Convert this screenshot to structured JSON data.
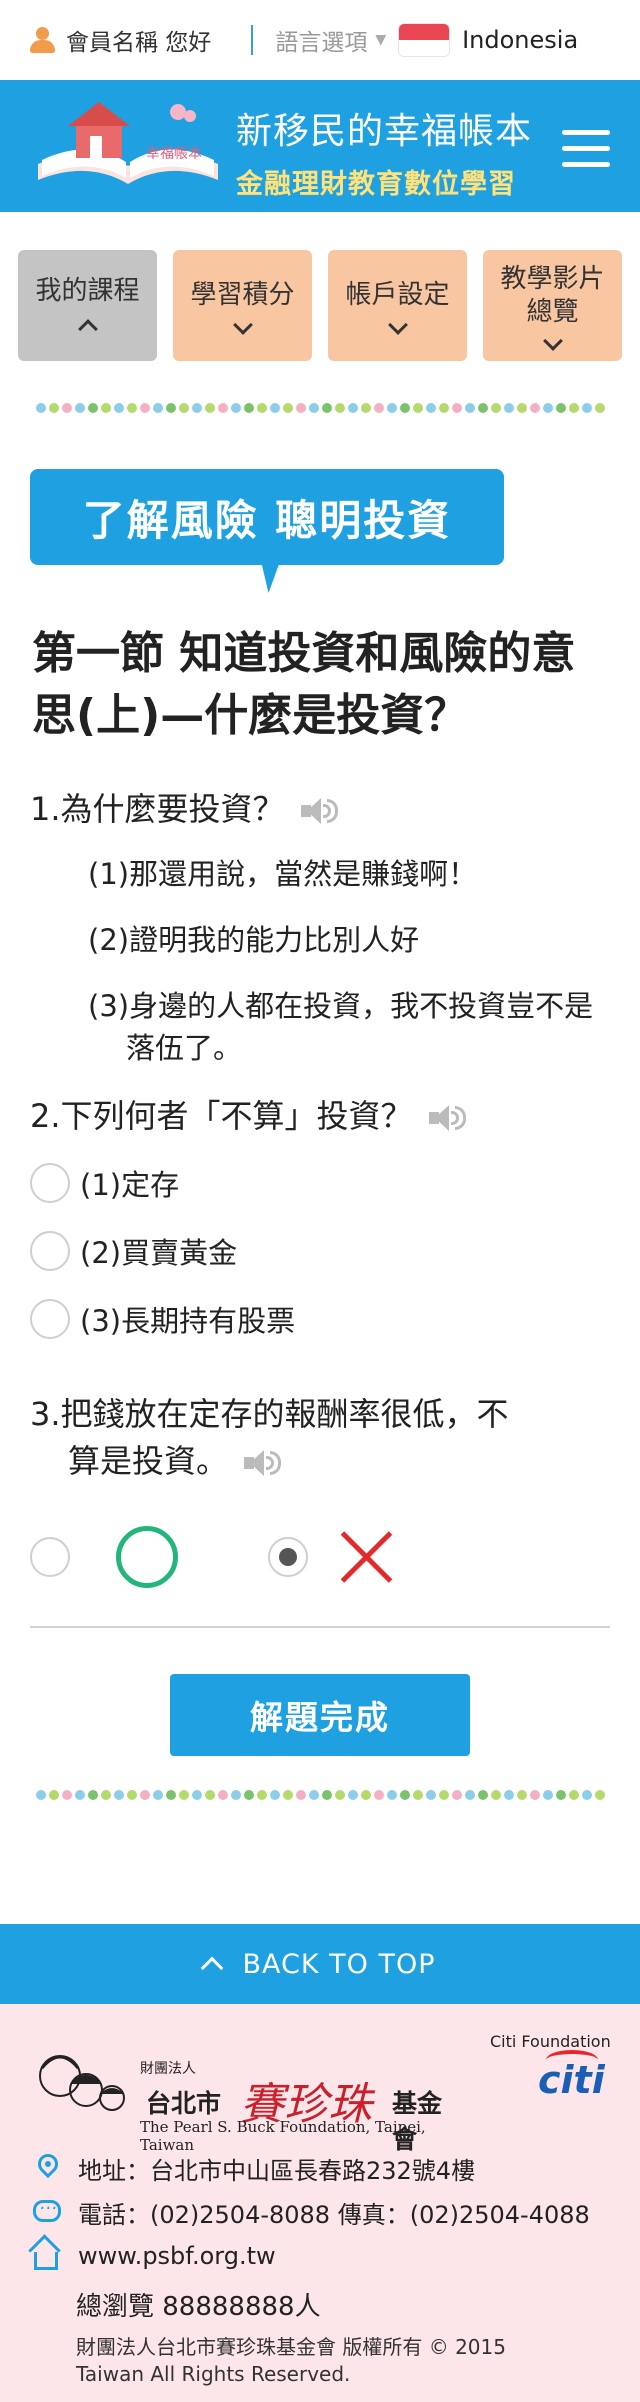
{
  "topbar": {
    "greeting": "會員名稱 您好",
    "lang_label": "語言選項",
    "lang_caret": "▼",
    "lang_current": "Indonesia"
  },
  "header": {
    "book_caption": "幸福帳本",
    "title_line1": "新移民的幸福帳本",
    "title_line2": "金融理財教育數位學習"
  },
  "tabs": [
    {
      "label": "我的課程",
      "active": true
    },
    {
      "label": "學習積分",
      "active": false
    },
    {
      "label": "帳戶設定",
      "active": false
    },
    {
      "label": "教學影片\n總覽",
      "active": false
    }
  ],
  "lesson": {
    "banner": "了解風險 聰明投資",
    "section_title": "第一節 知道投資和風險的意思(上)—什麼是投資？"
  },
  "q1": {
    "title": "1.為什麼要投資？",
    "options": [
      "(1)那還用說，當然是賺錢啊！",
      "(2)證明我的能力比別人好",
      "(3)身邊的人都在投資，我不投資豈不是落伍了。"
    ]
  },
  "q2": {
    "title": "2.下列何者「不算」投資？",
    "options": [
      "(1)定存",
      "(2)買賣黃金",
      "(3)長期持有股票"
    ]
  },
  "q3": {
    "title_a": "3.把錢放在定存的報酬率很低，不",
    "title_b": "算是投資。",
    "selected": "false"
  },
  "submit_label": "解題完成",
  "back_to_top": "BACK TO TOP",
  "footer": {
    "org_prefix": "財團法人",
    "org_city": "台北市",
    "org_name": "賽珍珠",
    "org_suffix": "基金會",
    "org_en": "The Pearl S. Buck Foundation, Taipei, Taiwan",
    "citi_foundation": "Citi Foundation",
    "citi": "citi",
    "address": "地址：台北市中山區長春路232號4樓",
    "phone": "電話：(02)2504-8088  傳真：(02)2504-4088",
    "website": "www.psbf.org.tw",
    "views": "總瀏覽 88888888人",
    "copyright_1": "財團法人台北市賽珍珠基金會 版權所有 © 2015",
    "copyright_2": "Taiwan All Rights Reserved."
  },
  "colors": {
    "primary": "#1ea0e1",
    "tab": "#f9c6a2",
    "tab_active": "#c4c4c4",
    "footer_bg": "#fde6ea",
    "correct": "#23b67b",
    "wrong": "#e32a2a"
  },
  "icons": [
    "user-icon",
    "speaker-icon",
    "hamburger-icon",
    "location-pin-icon",
    "chat-icon",
    "home-icon",
    "chevron-up-icon",
    "chevron-down-icon"
  ]
}
